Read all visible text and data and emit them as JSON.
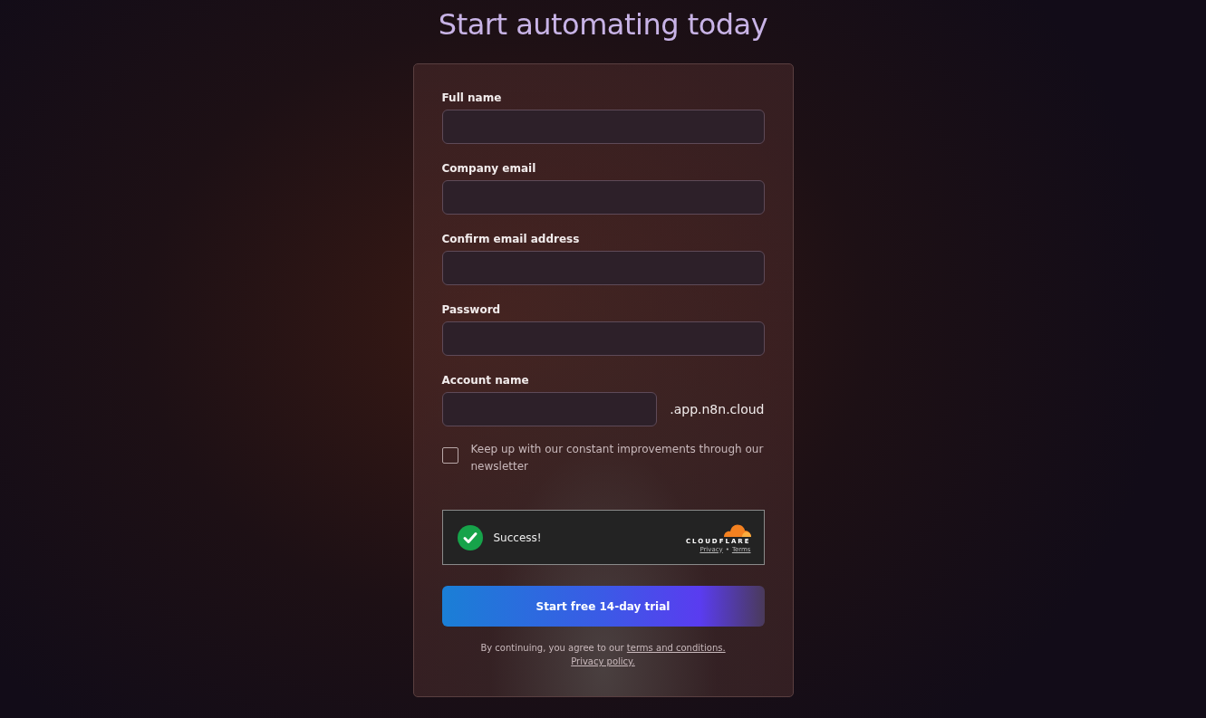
{
  "title": "Start automating today",
  "fields": [
    {
      "label": "Full name"
    },
    {
      "label": "Company email"
    },
    {
      "label": "Confirm email address"
    },
    {
      "label": "Password"
    },
    {
      "label": "Account name",
      "suffix": ".app.n8n.cloud"
    }
  ],
  "newsletter": {
    "label": "Keep up with our constant improvements through our newsletter",
    "checked": false
  },
  "captcha": {
    "status": "Success!",
    "verified": true,
    "brand": "CLOUDFLARE",
    "links": [
      "Privacy",
      "Terms"
    ],
    "separator": "•"
  },
  "submit": "Start free 14-day trial",
  "legal": {
    "text": "By continuing, you agree to our ",
    "terms_link": "terms and conditions.",
    "privacy_link": "Privacy policy."
  }
}
